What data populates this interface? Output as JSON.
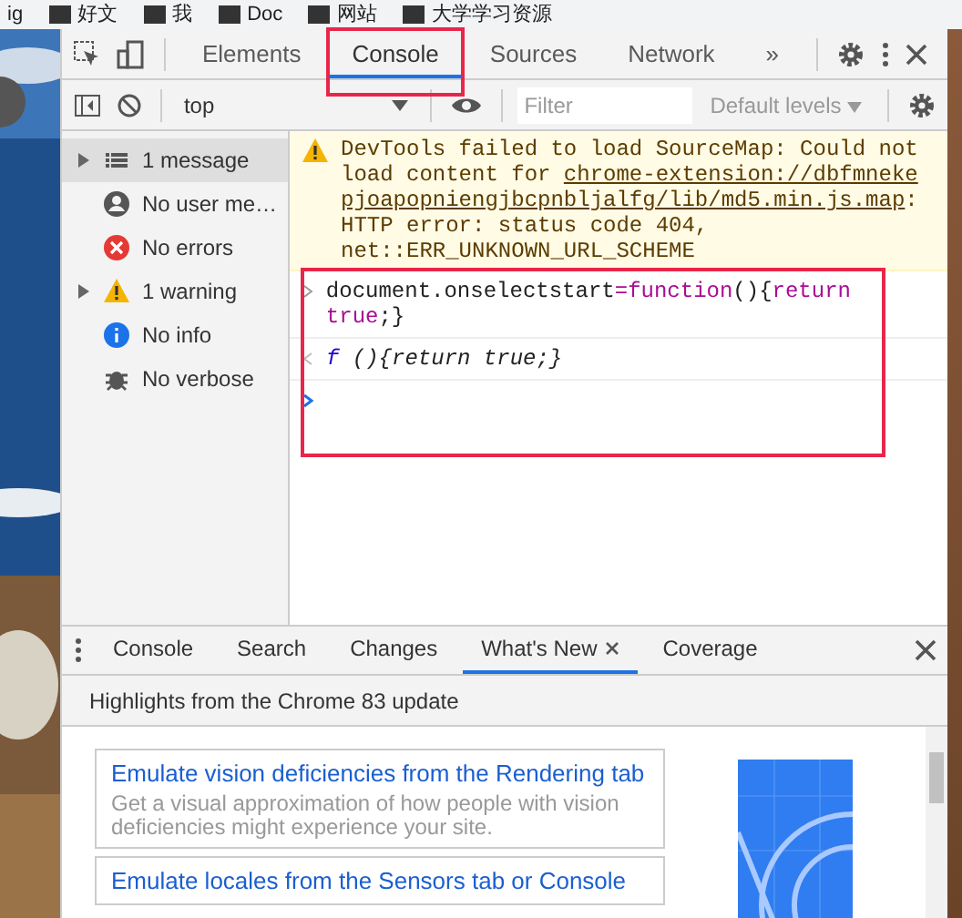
{
  "bookmarks": [
    {
      "label": "ig",
      "kind": "text"
    },
    {
      "label": "好文",
      "kind": "folder"
    },
    {
      "label": "我",
      "kind": "folder"
    },
    {
      "label": "Doc",
      "kind": "folder"
    },
    {
      "label": "网站",
      "kind": "folder"
    },
    {
      "label": "大学学习资源",
      "kind": "folder"
    }
  ],
  "devtools": {
    "tabs": [
      {
        "label": "Elements",
        "selected": false,
        "highlighted": false
      },
      {
        "label": "Console",
        "selected": true,
        "highlighted": true
      },
      {
        "label": "Sources",
        "selected": false,
        "highlighted": false
      },
      {
        "label": "Network",
        "selected": false,
        "highlighted": false
      }
    ],
    "overflow": "»",
    "context": "top",
    "filter": {
      "placeholder": "Filter"
    },
    "levels": "Default levels"
  },
  "sidebar": {
    "items": [
      {
        "label": "1 message",
        "kind": "list",
        "expandable": true,
        "selected": true
      },
      {
        "label": "No user me…",
        "kind": "user",
        "expandable": false,
        "selected": false
      },
      {
        "label": "No errors",
        "kind": "error",
        "expandable": false,
        "selected": false
      },
      {
        "label": "1 warning",
        "kind": "warning",
        "expandable": true,
        "selected": false
      },
      {
        "label": "No info",
        "kind": "info",
        "expandable": false,
        "selected": false
      },
      {
        "label": "No verbose",
        "kind": "verbose",
        "expandable": false,
        "selected": false
      }
    ]
  },
  "console": {
    "warning": [
      [
        {
          "text": "DevTools failed to load SourceMap: Could not",
          "link": false
        }
      ],
      [
        {
          "text": "load content for ",
          "link": false
        },
        {
          "text": "chrome-extension://dbfmneke",
          "link": true
        }
      ],
      [
        {
          "text": "pjoapopniengjbcpnbljalfg/lib/md5.min.js.map",
          "link": true
        },
        {
          "text": ":",
          "link": false
        }
      ],
      [
        {
          "text": "HTTP error: status code 404,",
          "link": false
        }
      ],
      [
        {
          "text": "net::ERR_UNKNOWN_URL_SCHEME",
          "link": false
        }
      ]
    ],
    "input": [
      {
        "text": "document.onselectstart",
        "kind": "plain"
      },
      {
        "text": "=",
        "kind": "keyword"
      },
      {
        "text": "function",
        "kind": "keyword"
      },
      {
        "text": "(){",
        "kind": "plain"
      },
      {
        "text": "return true",
        "kind": "keyword"
      },
      {
        "text": ";}",
        "kind": "plain"
      }
    ],
    "result": [
      {
        "text": "f",
        "kind": "fn"
      },
      {
        "text": " (){return true;}",
        "kind": "plain"
      }
    ],
    "input_highlighted": true
  },
  "drawer": {
    "tabs": [
      {
        "label": "Console",
        "selected": false,
        "closable": false
      },
      {
        "label": "Search",
        "selected": false,
        "closable": false
      },
      {
        "label": "Changes",
        "selected": false,
        "closable": false
      },
      {
        "label": "What's New",
        "selected": true,
        "closable": true
      },
      {
        "label": "Coverage",
        "selected": false,
        "closable": false
      }
    ],
    "headline": "Highlights from the Chrome 83 update",
    "cards": [
      {
        "title": "Emulate vision deficiencies from the Rendering tab",
        "description": "Get a visual approximation of how people with vision deficiencies might experience your site."
      },
      {
        "title": "Emulate locales from the Sensors tab or Console"
      }
    ]
  }
}
